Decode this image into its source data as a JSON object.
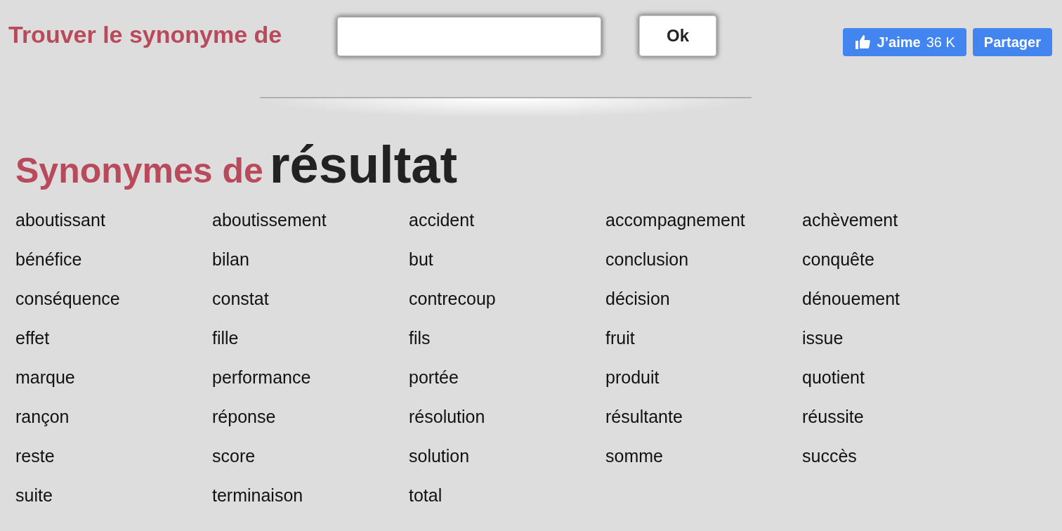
{
  "search": {
    "label": "Trouver le synonyme de",
    "button": "Ok"
  },
  "social": {
    "like": "J’aime",
    "like_count": "36 K",
    "share": "Partager"
  },
  "heading": {
    "prefix": "Synonymes de",
    "word": "résultat"
  },
  "synonyms": [
    "aboutissant",
    "aboutissement",
    "accident",
    "accompagnement",
    "achèvement",
    "bénéfice",
    "bilan",
    "but",
    "conclusion",
    "conquête",
    "conséquence",
    "constat",
    "contrecoup",
    "décision",
    "dénouement",
    "effet",
    "fille",
    "fils",
    "fruit",
    "issue",
    "marque",
    "performance",
    "portée",
    "produit",
    "quotient",
    "rançon",
    "réponse",
    "résolution",
    "résultante",
    "réussite",
    "reste",
    "score",
    "solution",
    "somme",
    "succès",
    "suite",
    "terminaison",
    "total"
  ]
}
